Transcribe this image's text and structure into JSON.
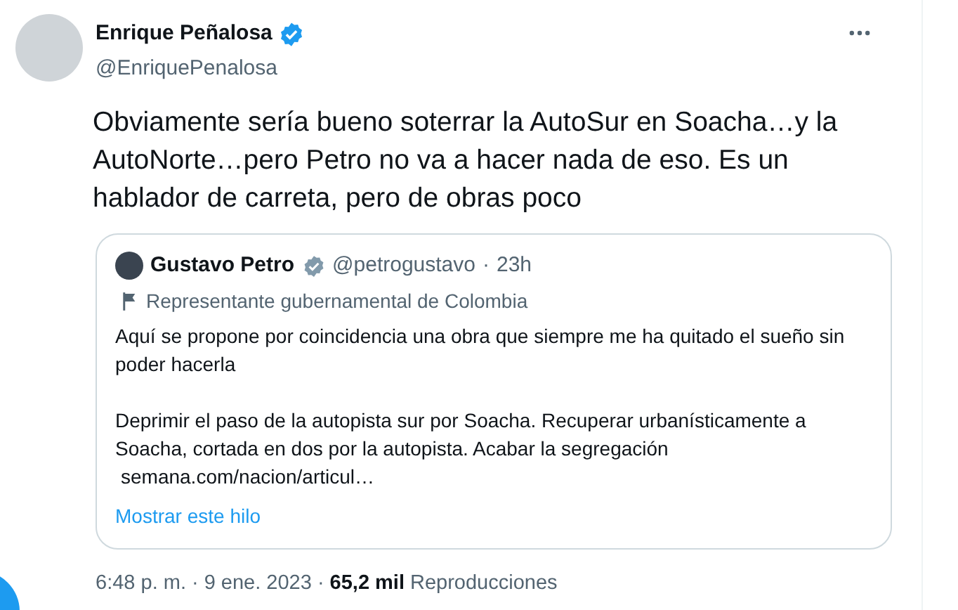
{
  "author": {
    "name": "Enrique Peñalosa",
    "handle": "@EnriquePenalosa",
    "verified": true
  },
  "text": "Obviamente sería bueno soterrar la AutoSur en Soacha…y la AutoNorte…pero Petro no va a hacer nada de eso. Es un hablador de carreta, pero de obras poco",
  "quote": {
    "name": "Gustavo Petro",
    "verified": true,
    "handle": "@petrogustavo",
    "separator": "·",
    "time": "23h",
    "label": "Representante gubernamental de Colombia",
    "paragraphs": [
      "Aquí se propone por coincidencia una obra que siempre me ha quitado el sueño sin poder hacerla",
      "Deprimir el paso de la autopista sur por Soacha. Recuperar urbanísticamente a Soacha, cortada en dos por la autopista. Acabar la segregación"
    ],
    "link": "semana.com/nacion/articul…",
    "show_thread": "Mostrar este hilo"
  },
  "meta": {
    "time": "6:48 p. m.",
    "separator": "·",
    "date": "9 ene. 2023",
    "separator2": "·",
    "views": "65,2 mil",
    "views_label": "Reproducciones"
  }
}
